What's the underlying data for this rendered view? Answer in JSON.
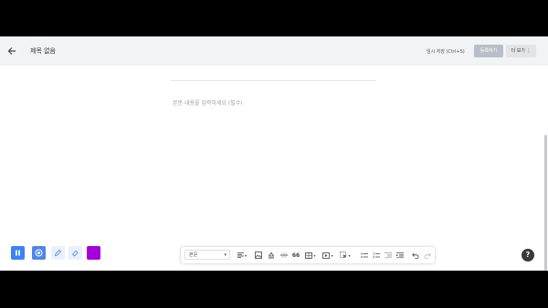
{
  "header": {
    "title": "제목 없음",
    "save_draft": "임시 저장 (Ctrl+S)",
    "register_button": "등록하기",
    "more_button": "더 보기"
  },
  "editor": {
    "placeholder": "본문 내용을 입력하세요 (필수)"
  },
  "left_tools": [
    {
      "name": "pause",
      "icon": "pause-icon",
      "color": "#3b82f6"
    },
    {
      "name": "target",
      "icon": "target-icon",
      "color": "#4f86e8"
    },
    {
      "name": "pen",
      "icon": "pen-icon",
      "color": "#e8f1fd"
    },
    {
      "name": "eraser",
      "icon": "eraser-icon",
      "color": "#e8f1fd"
    },
    {
      "name": "color",
      "icon": "color-swatch",
      "color": "#a400d9"
    }
  ],
  "toolbar": {
    "format_select": "본문",
    "quote_label": "66"
  },
  "help": "?"
}
